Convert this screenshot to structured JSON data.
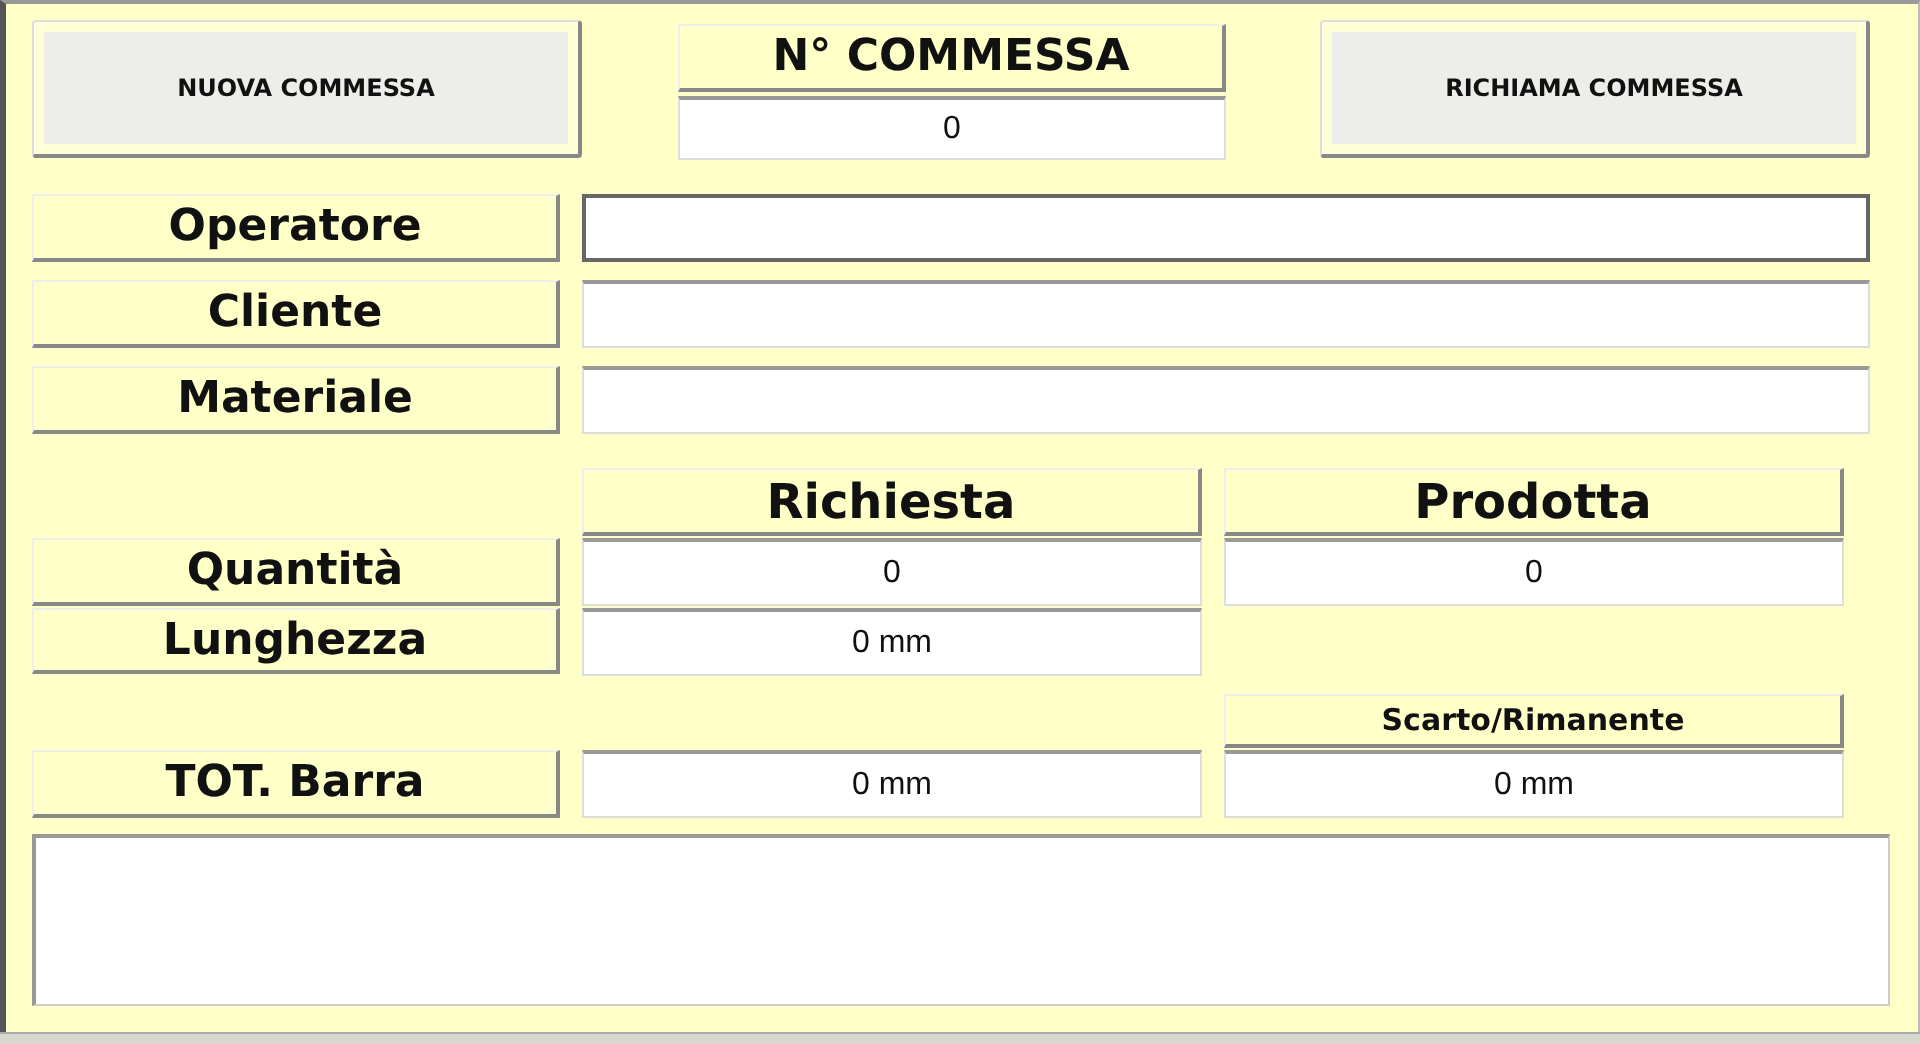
{
  "top": {
    "new_button": "NUOVA COMMESSA",
    "order_number": {
      "label": "N° COMMESSA",
      "value": "0"
    },
    "recall_button": "RICHIAMA COMMESSA"
  },
  "fields": [
    {
      "label": "Operatore",
      "focused": true
    },
    {
      "label": "Cliente",
      "focused": false
    },
    {
      "label": "Materiale",
      "focused": false
    }
  ],
  "quantities": {
    "columns": [
      "Richiesta",
      "Prodotta"
    ],
    "rows": [
      {
        "label": "Quantità",
        "values": [
          "0",
          "0"
        ]
      },
      {
        "label": "Lunghezza",
        "values": [
          "0 mm"
        ]
      }
    ],
    "waste_header": "Scarto/Rimanente",
    "total": {
      "label": "TOT. Barra",
      "values": [
        "0 mm",
        "0 mm"
      ]
    }
  }
}
